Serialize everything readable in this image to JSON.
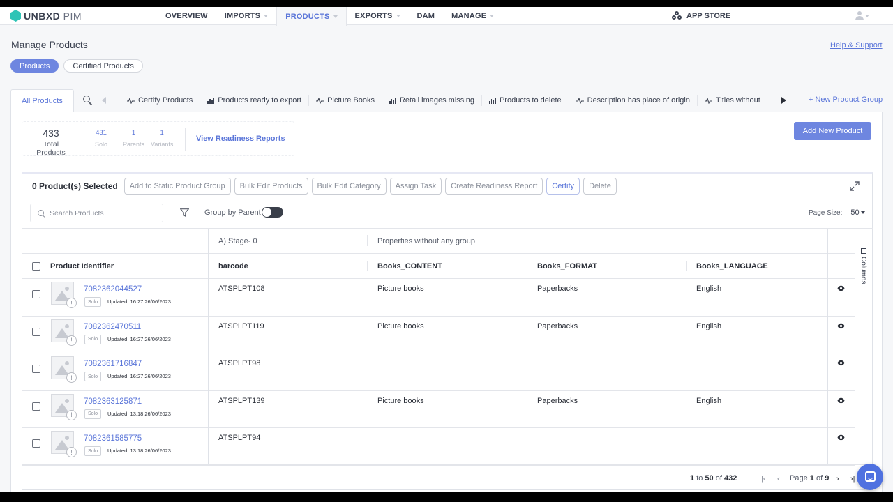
{
  "app": {
    "brand": "UNBXD",
    "product": "PIM"
  },
  "nav": {
    "items": [
      {
        "label": "OVERVIEW",
        "caret": false,
        "active": false
      },
      {
        "label": "IMPORTS",
        "caret": true,
        "active": false
      },
      {
        "label": "PRODUCTS",
        "caret": true,
        "active": true
      },
      {
        "label": "EXPORTS",
        "caret": true,
        "active": false
      },
      {
        "label": "DAM",
        "caret": false,
        "active": false
      },
      {
        "label": "MANAGE",
        "caret": true,
        "active": false
      }
    ],
    "app_store": "APP STORE"
  },
  "page": {
    "title": "Manage Products",
    "help": "Help & Support"
  },
  "pills": {
    "products": "Products",
    "certified": "Certified Products"
  },
  "group_tabs": {
    "all": "All Products",
    "items": [
      {
        "label": "Certify Products",
        "icon": "pulse"
      },
      {
        "label": "Products ready to export",
        "icon": "bars"
      },
      {
        "label": "Picture Books",
        "icon": "pulse"
      },
      {
        "label": "Retail images missing",
        "icon": "bars"
      },
      {
        "label": "Products to delete",
        "icon": "bars"
      },
      {
        "label": "Description has place of origin",
        "icon": "pulse"
      },
      {
        "label": "Titles without",
        "icon": "pulse"
      }
    ],
    "new_group": "+ New Product Group"
  },
  "stats": {
    "total": "433",
    "total_label": "Total Products",
    "solo": "431",
    "solo_label": "Solo",
    "parents": "1",
    "parents_label": "Parents",
    "variants": "1",
    "variants_label": "Variants",
    "view_reports": "View Readiness Reports"
  },
  "add_new": "Add New Product",
  "actions": {
    "selected": "0 Product(s) Selected",
    "buttons": [
      {
        "label": "Add to Static Product Group",
        "primary": false
      },
      {
        "label": "Bulk Edit Products",
        "primary": false
      },
      {
        "label": "Bulk Edit Category",
        "primary": false
      },
      {
        "label": "Assign Task",
        "primary": false
      },
      {
        "label": "Create Readiness Report",
        "primary": false
      },
      {
        "label": "Certify",
        "primary": true
      },
      {
        "label": "Delete",
        "primary": false
      }
    ]
  },
  "toolbar": {
    "search_placeholder": "Search Products",
    "group_by_parent": "Group by Parent",
    "page_size_label": "Page Size:",
    "page_size": "50"
  },
  "grid": {
    "groups": {
      "stage": "A) Stage- 0",
      "ungrouped": "Properties without any group"
    },
    "headers": {
      "identifier": "Product Identifier",
      "barcode": "barcode",
      "content": "Books_CONTENT",
      "format": "Books_FORMAT",
      "language": "Books_LANGUAGE"
    },
    "columns_label": "Columns",
    "rows": [
      {
        "id": "7082362044527",
        "badge": "Solo",
        "updated": "Updated: 16:27 26/06/2023",
        "barcode": "ATSPLPT108",
        "content": "Picture books",
        "format": "Paperbacks",
        "language": "English"
      },
      {
        "id": "7082362470511",
        "badge": "Solo",
        "updated": "Updated: 16:27 26/06/2023",
        "barcode": "ATSPLPT119",
        "content": "Picture books",
        "format": "Paperbacks",
        "language": "English"
      },
      {
        "id": "7082361716847",
        "badge": "Solo",
        "updated": "Updated: 16:27 26/06/2023",
        "barcode": "ATSPLPT98",
        "content": "",
        "format": "",
        "language": ""
      },
      {
        "id": "7082363125871",
        "badge": "Solo",
        "updated": "Updated: 13:18 26/06/2023",
        "barcode": "ATSPLPT139",
        "content": "Picture books",
        "format": "Paperbacks",
        "language": "English"
      },
      {
        "id": "7082361585775",
        "badge": "Solo",
        "updated": "Updated: 13:18 26/06/2023",
        "barcode": "ATSPLPT94",
        "content": "",
        "format": "",
        "language": ""
      }
    ]
  },
  "pagination": {
    "from": "1",
    "to_word": "to",
    "to": "50",
    "of_word": "of",
    "total": "432",
    "page_word": "Page",
    "page": "1",
    "page_of": "of",
    "pages": "9"
  },
  "colors": {
    "accent": "#5b76d9",
    "button": "#6e86e0",
    "logo": "#2ec4b6"
  }
}
